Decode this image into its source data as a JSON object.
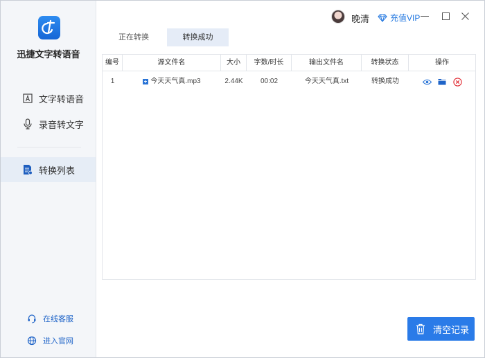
{
  "app": {
    "name": "迅捷文字转语音"
  },
  "sidebar": {
    "items": [
      {
        "label": "文字转语音",
        "icon": "text-a-icon"
      },
      {
        "label": "录音转文字",
        "icon": "microphone-icon"
      },
      {
        "label": "转换列表",
        "icon": "document-list-icon",
        "active": true
      }
    ],
    "footer": [
      {
        "label": "在线客服",
        "icon": "headset-icon"
      },
      {
        "label": "进入官网",
        "icon": "globe-icon"
      }
    ]
  },
  "header": {
    "username": "晚清",
    "vip_label": "充值VIP"
  },
  "tabs": [
    {
      "label": "正在转换",
      "active": false
    },
    {
      "label": "转换成功",
      "active": true
    }
  ],
  "table": {
    "columns": [
      "编号",
      "源文件名",
      "大小",
      "字数/时长",
      "输出文件名",
      "转换状态",
      "操作"
    ],
    "rows": [
      {
        "index": "1",
        "source_file": "今天天气真.mp3",
        "size": "2.44K",
        "duration": "00:02",
        "output_file": "今天天气真.txt",
        "status": "转换成功",
        "actions": [
          "eye-icon",
          "folder-icon",
          "delete-circle-icon"
        ]
      }
    ]
  },
  "clear_button": {
    "label": "清空记录"
  },
  "colors": {
    "accent": "#2a7be8",
    "delete": "#e0262e",
    "sidebar_active": "#e6edf6"
  }
}
